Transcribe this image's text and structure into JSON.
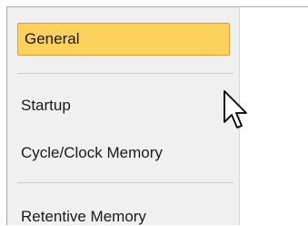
{
  "nav": {
    "items": [
      {
        "label": "General",
        "selected": true
      },
      {
        "label": "Startup",
        "selected": false
      },
      {
        "label": "Cycle/Clock Memory",
        "selected": false
      },
      {
        "label": "Retentive Memory",
        "selected": false
      }
    ]
  },
  "colors": {
    "selected_bg": "#fdd15e",
    "selected_border": "#e1a02b",
    "nav_bg": "#f0f0f0"
  },
  "icons": {
    "cursor": "mouse-pointer-icon"
  }
}
